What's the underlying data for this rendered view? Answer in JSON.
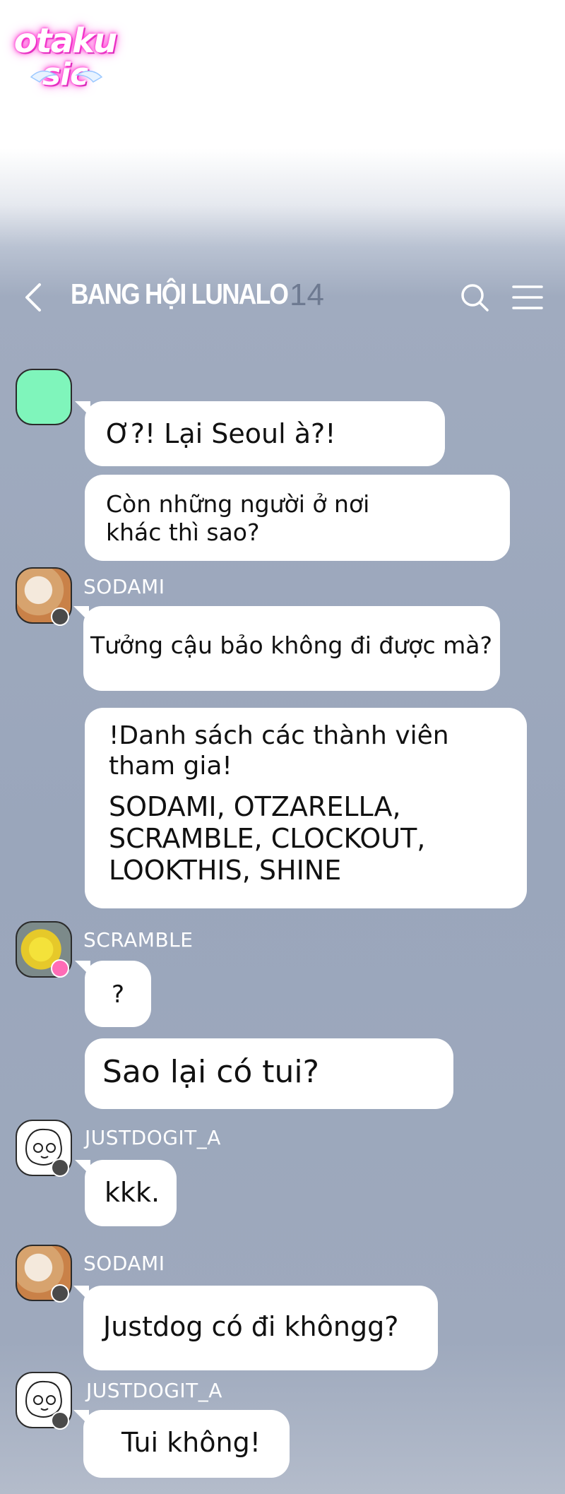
{
  "logo": {
    "line1": "otaku",
    "line2": "sic"
  },
  "header": {
    "title": "BANG HỘI LUNALO",
    "member_count": "14"
  },
  "messages": [
    {
      "text": "Ơ?! Lại Seoul à?!"
    },
    {
      "text": "Còn những người ở nơi khác thì sao?"
    },
    {
      "sender": "SODAMI",
      "text": "Tưởng cậu bảo không đi được mà?"
    },
    {
      "heading": "!Danh sách các thành viên tham gia!",
      "text": "SODAMI, OTZARELLA, SCRAMBLE, CLOCKOUT, LOOKTHIS, SHINE"
    },
    {
      "sender": "SCRAMBLE",
      "text": "?"
    },
    {
      "text": "Sao lại có tui?"
    },
    {
      "sender": "JUSTDOGIT_A",
      "text": "kkk."
    },
    {
      "sender": "SODAMI",
      "text": "Justdog có đi khôngg?"
    },
    {
      "sender": "JUSTDOGIT_A",
      "text": "Tui không!"
    }
  ],
  "colors": {
    "bubble": "#ffffff",
    "username": "#ffffff",
    "count": "#6e7a91",
    "avatar_green": "#7ff5bb",
    "logo_glow": "#ff2fd0"
  },
  "icons": [
    "back-icon",
    "search-icon",
    "menu-icon",
    "member-badge-icon",
    "crown-badge-icon"
  ]
}
